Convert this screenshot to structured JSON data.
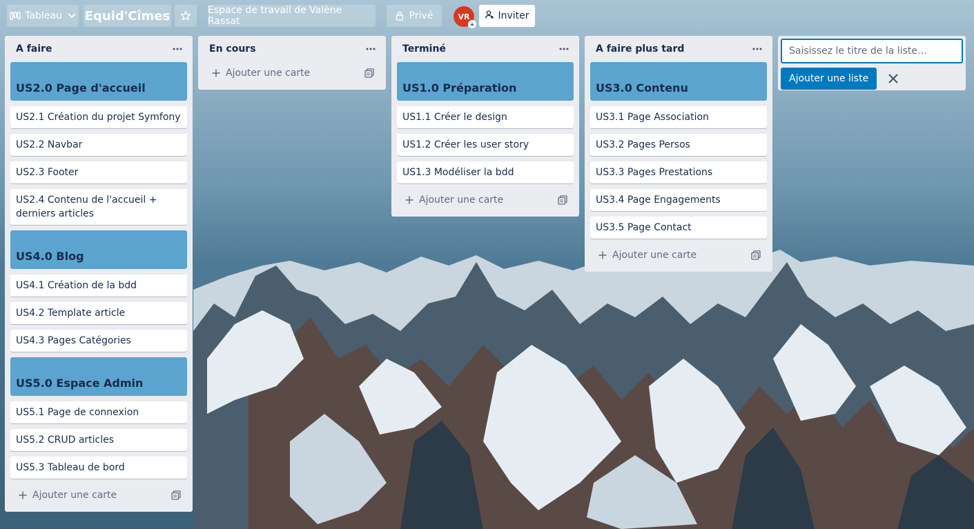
{
  "header": {
    "view_label": "Tableau",
    "board_title": "Equid'Cîmes",
    "workspace_label": "Espace de travail de Valène Rassat",
    "visibility_label": "Privé",
    "avatar_initials": "VR",
    "invite_label": "Inviter",
    "icons": [
      "board-view-icon",
      "chevron-down-icon",
      "star-icon",
      "lock-icon",
      "add-person-icon"
    ]
  },
  "colors": {
    "cover": "#5ba4cf",
    "list_bg": "#ebecf0",
    "primary": "#0079bf",
    "avatar": "#d9381e"
  },
  "lists": [
    {
      "title": "A faire",
      "cards": [
        {
          "text": "US2.0 Page d'accueil",
          "cover": true
        },
        {
          "text": "US2.1 Création du projet Symfony"
        },
        {
          "text": "US2.2 Navbar"
        },
        {
          "text": "US2.3 Footer"
        },
        {
          "text": "US2.4 Contenu de l'accueil + derniers articles"
        },
        {
          "text": "US4.0 Blog",
          "cover": true
        },
        {
          "text": "US4.1 Création de la bdd"
        },
        {
          "text": "US4.2 Template article"
        },
        {
          "text": "US4.3 Pages Catégories"
        },
        {
          "text": "US5.0 Espace Admin",
          "cover": true
        },
        {
          "text": "US5.1 Page de connexion"
        },
        {
          "text": "US5.2 CRUD articles"
        },
        {
          "text": "US5.3 Tableau de bord"
        }
      ]
    },
    {
      "title": "En cours",
      "cards": []
    },
    {
      "title": "Terminé",
      "cards": [
        {
          "text": "US1.0 Préparation",
          "cover": true
        },
        {
          "text": "US1.1 Créer le design"
        },
        {
          "text": "US1.2 Créer les user story"
        },
        {
          "text": "US1.3 Modéliser la bdd"
        }
      ]
    },
    {
      "title": "A faire plus tard",
      "cards": [
        {
          "text": "US3.0 Contenu",
          "cover": true
        },
        {
          "text": "US3.1 Page Association"
        },
        {
          "text": "US3.2 Pages Persos"
        },
        {
          "text": "US3.3 Pages Prestations"
        },
        {
          "text": "US3.4 Page Engagements"
        },
        {
          "text": "US3.5 Page Contact"
        }
      ]
    }
  ],
  "add_card_label": "Ajouter une carte",
  "add_list": {
    "placeholder": "Saisissez le titre de la liste…",
    "button_label": "Ajouter une liste"
  }
}
